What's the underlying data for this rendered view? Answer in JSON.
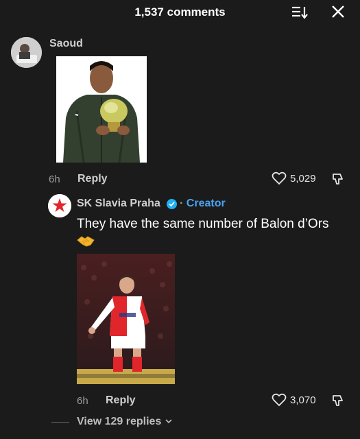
{
  "header": {
    "title": "1,537 comments",
    "sort_icon": "sort-icon",
    "close_icon": "close-icon"
  },
  "comment1": {
    "username": "Saoud",
    "image_description_icon": "photo",
    "time": "6h",
    "reply_label": "Reply",
    "likes": "5,029"
  },
  "comment2": {
    "username": "SK Slavia Praha",
    "separator": "·",
    "badge": "Creator",
    "text": "They have the same number of Balon d’Ors",
    "emoji_icon": "handshake-icon",
    "time": "6h",
    "reply_label": "Reply",
    "likes": "3,070",
    "view_replies": "View 129 replies"
  },
  "colors": {
    "background": "#1b1b1b",
    "creator_accent": "#4aa3f2",
    "slavia_red": "#e0262b"
  }
}
